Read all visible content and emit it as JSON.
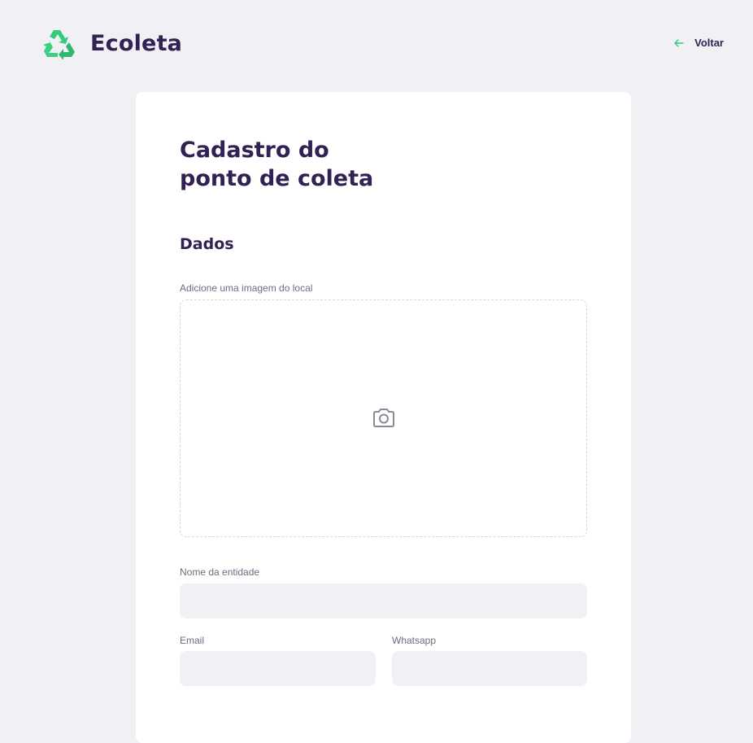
{
  "header": {
    "app_name": "Ecoleta",
    "logo_icon": "recycle-icon",
    "back_label": "Voltar",
    "back_icon": "arrow-left-icon"
  },
  "form": {
    "title_line1": "Cadastro do",
    "title_line2": "ponto de coleta",
    "section_title": "Dados",
    "image_upload": {
      "label": "Adicione uma imagem do local",
      "icon": "camera-icon"
    },
    "name_field": {
      "label": "Nome da entidade",
      "value": ""
    },
    "email_field": {
      "label": "Email",
      "value": ""
    },
    "whatsapp_field": {
      "label": "Whatsapp",
      "value": ""
    }
  },
  "colors": {
    "background": "#f0f0f5",
    "card": "#ffffff",
    "title": "#322153",
    "label": "#6c6c80",
    "brand_green": "#34cb79"
  }
}
